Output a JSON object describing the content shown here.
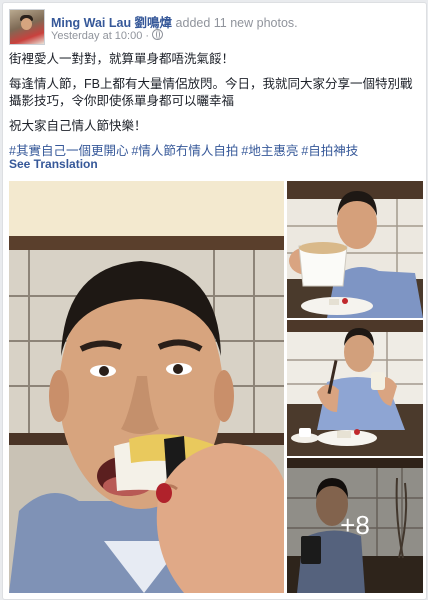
{
  "post": {
    "author_name": "Ming Wai Lau 劉鳴煒",
    "action": " added 11 new photos.",
    "timestamp": "Yesterday at 10:00",
    "separator": "·",
    "privacy_icon": "globe-icon",
    "paragraphs": [
      "街裡愛人一對對，就算單身都唔洗氣餒！",
      "每逢情人節，FB上都有大量情侶放閃。今日，我就同大家分享一個特別戰攝影技巧，令你即使係單身都可以曬幸福",
      "祝大家自己情人節快樂！"
    ],
    "hashtags": [
      "#其實自己一個更開心",
      "#情人節冇情人自拍",
      "#地主惠亮",
      "#自拍神技"
    ],
    "see_translation": "See Translation",
    "more_photos_label": "+8"
  },
  "colors": {
    "link": "#365899",
    "meta": "#90949c",
    "text": "#1d2129",
    "background": "#e9ebee"
  }
}
